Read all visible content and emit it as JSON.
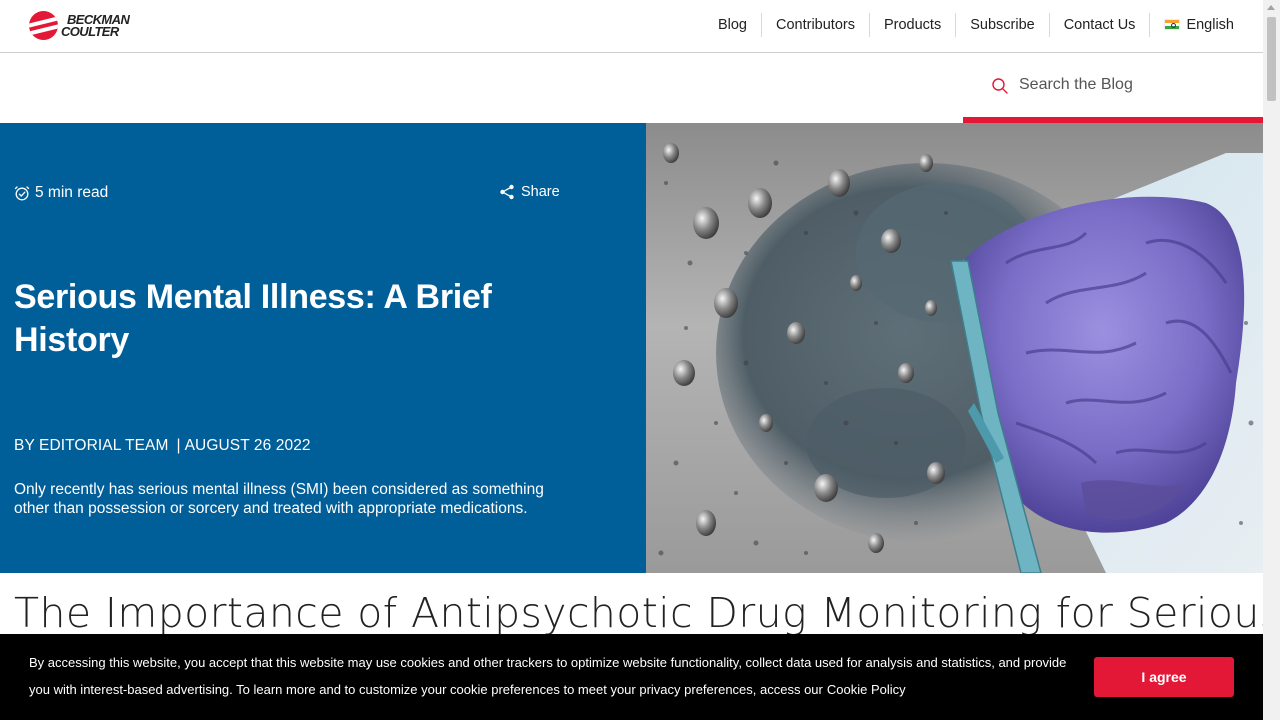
{
  "brand": {
    "line1": "BECKMAN",
    "line2": "COULTER"
  },
  "nav": {
    "items": [
      "Blog",
      "Contributors",
      "Products",
      "Subscribe",
      "Contact Us"
    ],
    "language": "English"
  },
  "search": {
    "placeholder": "Search the Blog"
  },
  "hero": {
    "read_time": "5 min read",
    "share_label": "Share",
    "title": "Serious Mental Illness: A Brief History",
    "author": "BY EDITORIAL TEAM",
    "date": "AUGUST 26 2022",
    "summary": "Only recently has serious mental illness (SMI) been considered as something other than possession or sorcery and treated with appropriate medications."
  },
  "article": {
    "heading": "The Importance of Antipsychotic Drug Monitoring for Serious"
  },
  "cookie": {
    "text": "By accessing this website, you accept that this website may use cookies and other trackers to optimize website functionality, collect data used for analysis and statistics, and provide you with interest-based advertising. To learn more and to customize your cookie preferences to meet your privacy preferences, access our",
    "link_label": "Cookie Policy",
    "agree_label": "I agree"
  },
  "colors": {
    "brand_red": "#e31837",
    "hero_blue": "#005e99"
  }
}
